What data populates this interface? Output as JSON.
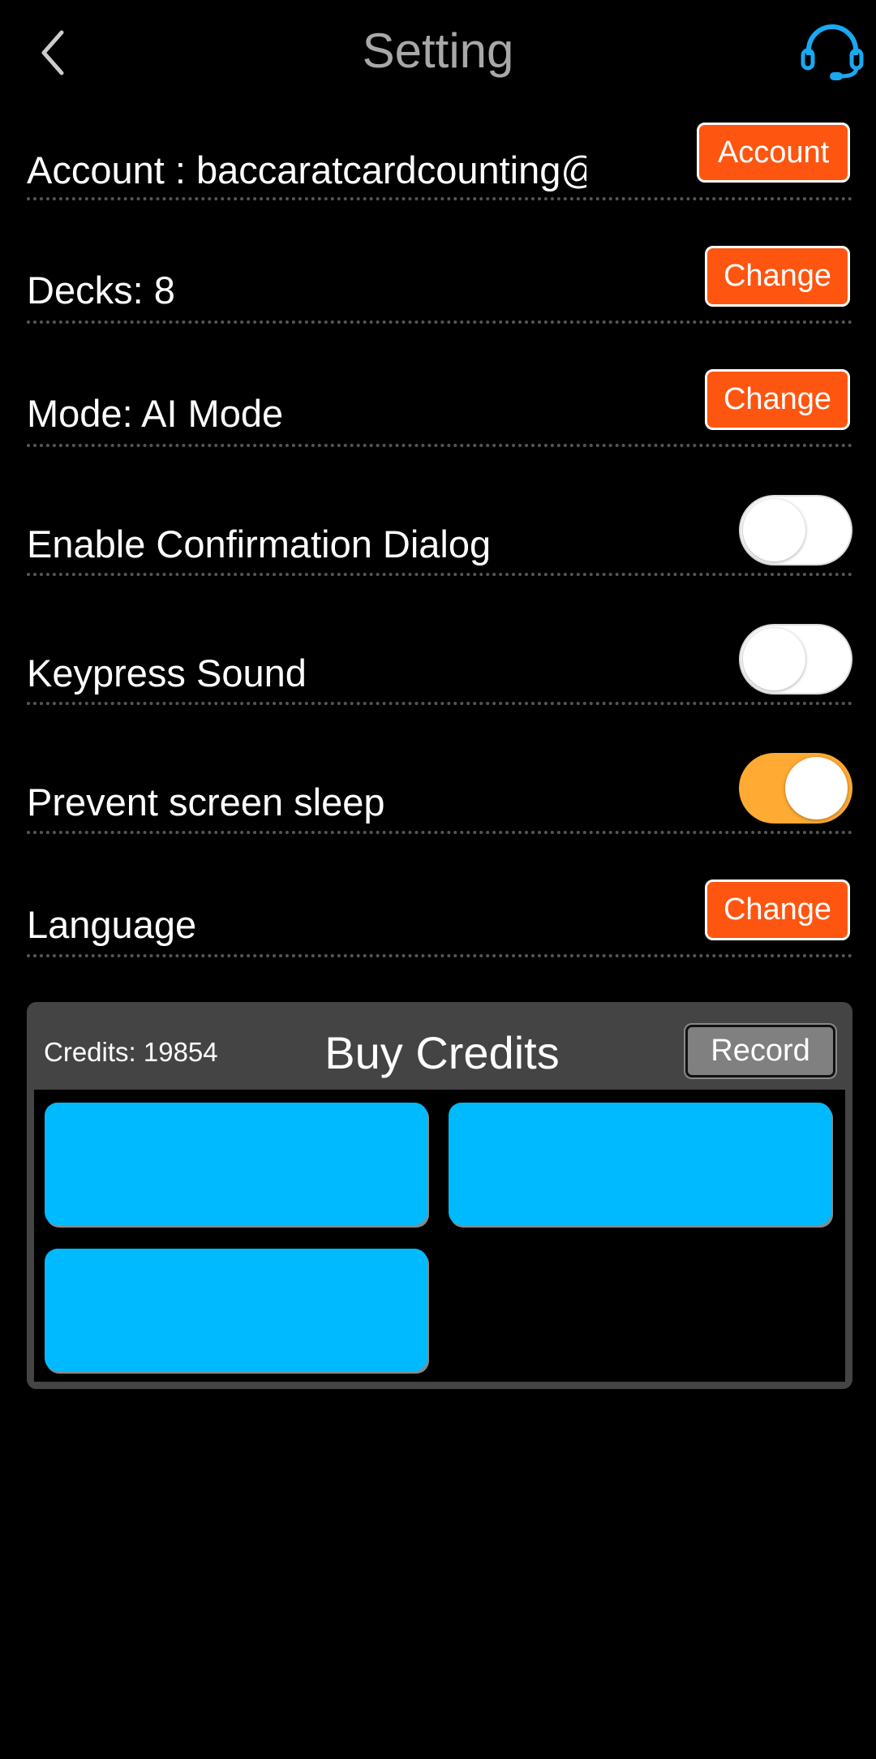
{
  "header": {
    "title": "Setting",
    "back_icon": "chevron-left-icon",
    "support_icon": "headset-icon",
    "support_color": "#1aa8f0"
  },
  "rows": [
    {
      "label": "Account : baccaratcardcounting@",
      "button": "Account"
    },
    {
      "label": "Decks: 8",
      "button": "Change"
    },
    {
      "label": "Mode: AI Mode",
      "button": "Change"
    },
    {
      "label": "Enable Confirmation Dialog",
      "toggle": false
    },
    {
      "label": "Keypress Sound",
      "toggle": false
    },
    {
      "label": "Prevent screen sleep",
      "toggle": true
    },
    {
      "label": "Language",
      "button": "Change"
    }
  ],
  "credits": {
    "credits_text": "Credits: 19854",
    "title": "Buy Credits",
    "record_label": "Record",
    "tile_color": "#00baff"
  },
  "colors": {
    "accent_button": "#fe5510",
    "toggle_on": "#ffaa33"
  }
}
